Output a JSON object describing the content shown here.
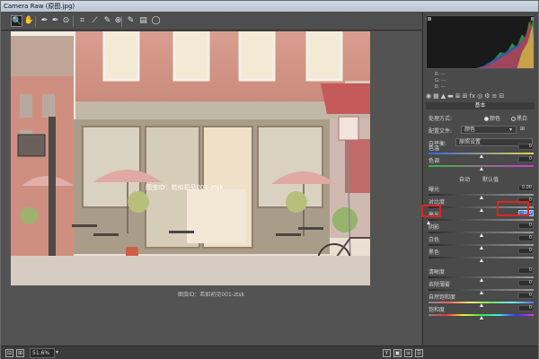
{
  "window": {
    "title": "Camera Raw (原图.jpg)"
  },
  "toolbar": {
    "tools": [
      {
        "name": "zoom-tool-icon",
        "glyph": "🔍"
      },
      {
        "name": "hand-tool-icon",
        "glyph": "✋"
      },
      {
        "name": "white-balance-tool-icon",
        "glyph": "✒"
      },
      {
        "name": "color-sampler-tool-icon",
        "glyph": "✒"
      },
      {
        "name": "targeted-adjustment-tool-icon",
        "glyph": "⊙"
      },
      {
        "name": "crop-tool-icon",
        "glyph": "⌗"
      },
      {
        "name": "straighten-tool-icon",
        "glyph": "⟋"
      },
      {
        "name": "spot-removal-tool-icon",
        "glyph": "✎"
      },
      {
        "name": "red-eye-tool-icon",
        "glyph": "⊛"
      },
      {
        "name": "adjustment-brush-icon",
        "glyph": "✎"
      },
      {
        "name": "graduated-filter-icon",
        "glyph": "▤"
      },
      {
        "name": "radial-filter-icon",
        "glyph": "◯"
      }
    ],
    "fullscreen_icon": "⇱"
  },
  "canvas": {
    "watermark": "图虫ID：若如初见001-ztsk",
    "caption": "图虫ID：若如初见001-ztsk"
  },
  "bottombar": {
    "zoom": "51.6%"
  },
  "histogram": {
    "rgb_labels": [
      "R:",
      "G:",
      "B:"
    ],
    "rgb_values": [
      "---",
      "---",
      "---"
    ]
  },
  "panel": {
    "tabs": [
      "◉",
      "▦",
      "▲",
      "▬",
      "≣",
      "⊞",
      "fx",
      "◎",
      "⚙",
      "≡",
      "⊟"
    ],
    "title": "基本",
    "process_label": "处理方式:",
    "process_options": [
      "颜色",
      "黑白"
    ],
    "process_selected": "颜色",
    "profile_label": "配置文件:",
    "profile_value": "颜色",
    "wb_label": "白平衡:",
    "wb_value": "原照设置",
    "auto_label": "自动",
    "default_label": "默认值",
    "sliders": [
      {
        "key": "temperature",
        "label": "色温",
        "value": "0",
        "pos": 0.5
      },
      {
        "key": "tint",
        "label": "色调",
        "value": "0",
        "pos": 0.5
      },
      {
        "key": "exposure",
        "label": "曝光",
        "value": "0.00",
        "pos": 0.5
      },
      {
        "key": "contrast",
        "label": "对比度",
        "value": "0",
        "pos": 0.5
      },
      {
        "key": "highlights",
        "label": "高光",
        "value": "-100",
        "pos": 0.0
      },
      {
        "key": "shadows",
        "label": "阴影",
        "value": "0",
        "pos": 0.5
      },
      {
        "key": "whites",
        "label": "白色",
        "value": "0",
        "pos": 0.5
      },
      {
        "key": "blacks",
        "label": "黑色",
        "value": "0",
        "pos": 0.5
      },
      {
        "key": "clarity",
        "label": "清晰度",
        "value": "0",
        "pos": 0.5
      },
      {
        "key": "dehaze",
        "label": "去除薄雾",
        "value": "0",
        "pos": 0.5
      },
      {
        "key": "vibrance",
        "label": "自然饱和度",
        "value": "0",
        "pos": 0.5
      },
      {
        "key": "saturation",
        "label": "饱和度",
        "value": "0",
        "pos": 0.5
      }
    ]
  }
}
